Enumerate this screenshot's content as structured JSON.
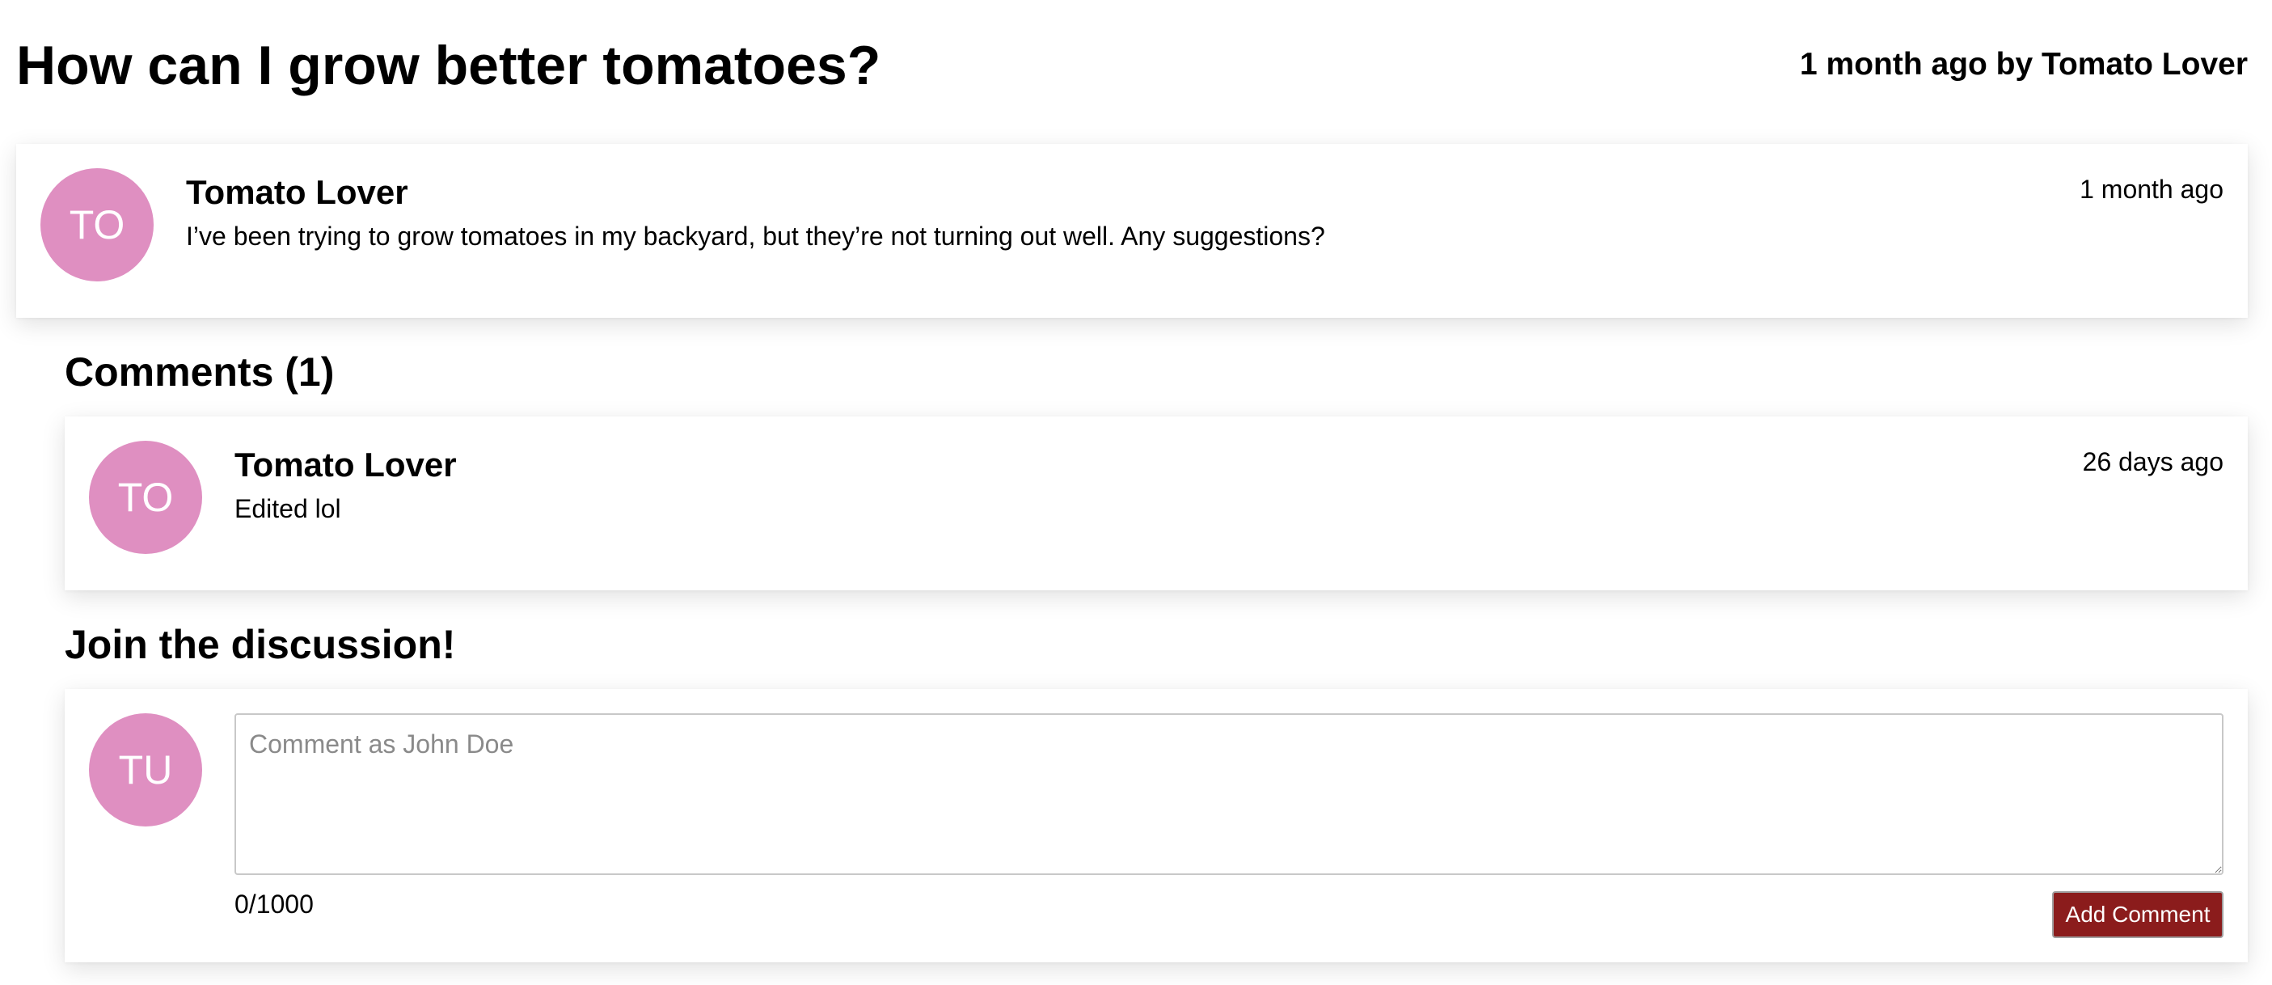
{
  "colors": {
    "avatar_background": "#df8fc1",
    "button_background": "#8b1c1c"
  },
  "post": {
    "title": "How can I grow better tomatoes?",
    "meta": "1 month ago by Tomato Lover",
    "avatar_initials": "TO",
    "author": "Tomato Lover",
    "timestamp": "1 month ago",
    "body": "I’ve been trying to grow tomatoes in my backyard, but they’re not turning out well. Any suggestions?"
  },
  "comments": {
    "heading": "Comments (1)",
    "items": [
      {
        "avatar_initials": "TO",
        "author": "Tomato Lover",
        "timestamp": "26 days ago",
        "body": "Edited lol"
      }
    ]
  },
  "comment_form": {
    "heading": "Join the discussion!",
    "avatar_initials": "TU",
    "placeholder": "Comment as John Doe",
    "value": "",
    "char_count": "0/1000",
    "submit_label": "Add Comment"
  }
}
